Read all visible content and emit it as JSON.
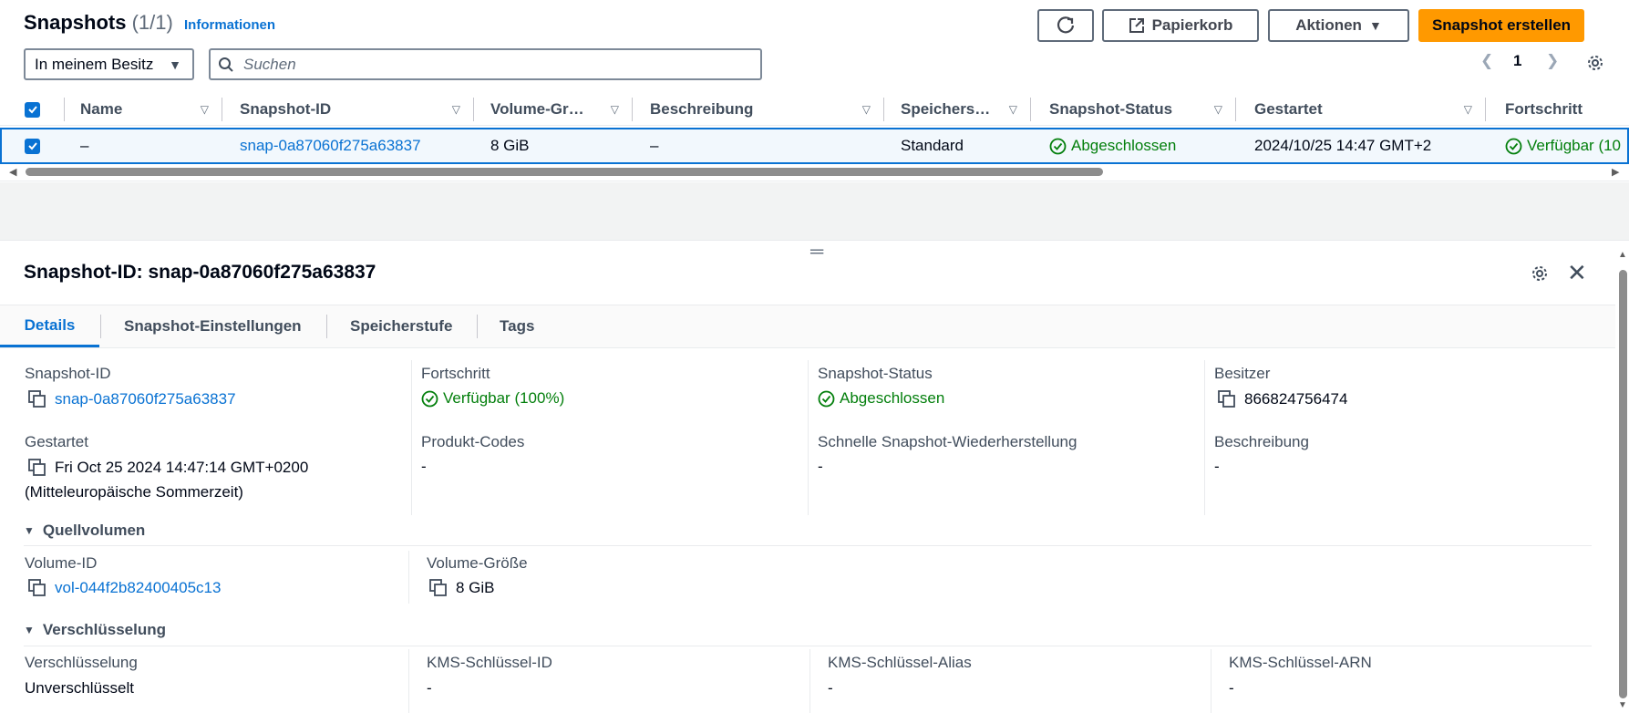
{
  "header": {
    "title": "Snapshots",
    "count": "(1/1)",
    "info_link": "Informationen",
    "buttons": {
      "trash": "Papierkorb",
      "actions": "Aktionen",
      "create": "Snapshot erstellen"
    }
  },
  "filter": {
    "owner_select": "In meinem Besitz",
    "search_placeholder": "Suchen"
  },
  "pagination": {
    "page": "1"
  },
  "table": {
    "columns": [
      "Name",
      "Snapshot-ID",
      "Volume-Gr…",
      "Beschreibung",
      "Speichers…",
      "Snapshot-Status",
      "Gestartet",
      "Fortschritt"
    ],
    "row": {
      "name": "–",
      "snapshot_id": "snap-0a87060f275a63837",
      "volume_size": "8 GiB",
      "description": "–",
      "storage_tier": "Standard",
      "status": "Abgeschlossen",
      "started": "2024/10/25 14:47 GMT+2",
      "progress": "Verfügbar (10"
    }
  },
  "details": {
    "title": "Snapshot-ID: snap-0a87060f275a63837",
    "tabs": [
      "Details",
      "Snapshot-Einstellungen",
      "Speicherstufe",
      "Tags"
    ],
    "fields": {
      "snapshot_id_label": "Snapshot-ID",
      "snapshot_id_value": "snap-0a87060f275a63837",
      "progress_label": "Fortschritt",
      "progress_value": "Verfügbar (100%)",
      "status_label": "Snapshot-Status",
      "status_value": "Abgeschlossen",
      "owner_label": "Besitzer",
      "owner_value": "866824756474",
      "started_label": "Gestartet",
      "started_value": "Fri Oct 25 2024 14:47:14 GMT+0200",
      "started_value_2": "(Mitteleuropäische Sommerzeit)",
      "product_codes_label": "Produkt-Codes",
      "product_codes_value": "-",
      "fast_restore_label": "Schnelle Snapshot-Wiederherstellung",
      "fast_restore_value": "-",
      "description_label": "Beschreibung",
      "description_value": "-"
    },
    "source_volume": {
      "heading": "Quellvolumen",
      "volume_id_label": "Volume-ID",
      "volume_id_value": "vol-044f2b82400405c13",
      "volume_size_label": "Volume-Größe",
      "volume_size_value": "8 GiB"
    },
    "encryption": {
      "heading": "Verschlüsselung",
      "encryption_label": "Verschlüsselung",
      "encryption_value": "Unverschlüsselt",
      "kms_id_label": "KMS-Schlüssel-ID",
      "kms_id_value": "-",
      "kms_alias_label": "KMS-Schlüssel-Alias",
      "kms_alias_value": "-",
      "kms_arn_label": "KMS-Schlüssel-ARN",
      "kms_arn_value": "-"
    }
  },
  "colors": {
    "link": "#0972d3",
    "success": "#037f0c",
    "primary_button": "#ff9900",
    "selected_row": "#f2f8fd"
  }
}
